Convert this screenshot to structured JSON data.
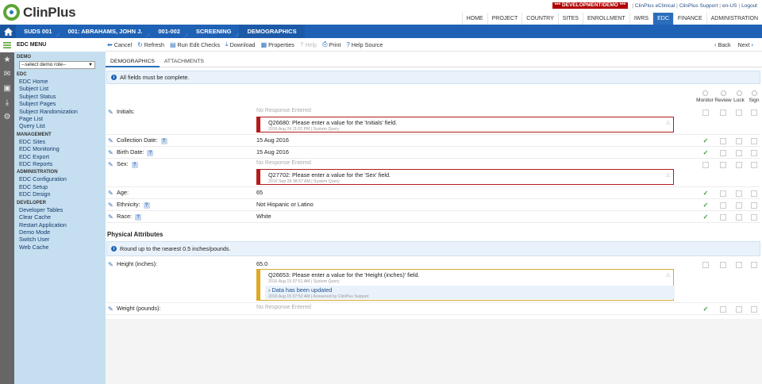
{
  "app": {
    "logo_text": "ClinPlus"
  },
  "top_links": {
    "environment": "*** DEVELOPMENT/DEMO ***",
    "eclinical": "ClinPlus eClinical",
    "support": "ClinPlus Support",
    "locale": "en-US",
    "logout": "Logout",
    "separator": "|"
  },
  "main_nav": [
    "HOME",
    "PROJECT",
    "COUNTRY",
    "SITES",
    "ENROLLMENT",
    "IWRS",
    "EDC",
    "FINANCE",
    "ADMINISTRATION"
  ],
  "main_nav_active": "EDC",
  "breadcrumbs": [
    "SUDS 001",
    "001: ABRAHAMS, JOHN J.",
    "001-002",
    "SCREENING",
    "DEMOGRAPHICS"
  ],
  "sidebar": {
    "title": "EDC MENU",
    "demo_label": "DEMO",
    "role_select": "--select demo role--",
    "sections": [
      {
        "title": "EDC",
        "items": [
          "EDC Home",
          "Subject List",
          "Subject Status",
          "Subject Pages",
          "Subject Randomization",
          "Page List",
          "Query List"
        ]
      },
      {
        "title": "MANAGEMENT",
        "items": [
          "EDC Sites",
          "EDC Monitoring",
          "EDC Export",
          "EDC Reports"
        ]
      },
      {
        "title": "ADMINISTRATION",
        "items": [
          "EDC Configuration",
          "EDC Setup",
          "EDC Design"
        ]
      },
      {
        "title": "DEVELOPER",
        "items": [
          "Developer Tables",
          "Clear Cache",
          "Restart Application",
          "Demo Mode",
          "Switch User",
          "Web Cache"
        ]
      }
    ]
  },
  "toolbar": {
    "cancel": "Cancel",
    "refresh": "Refresh",
    "run_edit_checks": "Run Edit Checks",
    "download": "Download",
    "properties": "Properties",
    "help": "Help",
    "print": "Print",
    "help_source": "Help Source",
    "back": "Back",
    "next": "Next"
  },
  "tabs": [
    "DEMOGRAPHICS",
    "ATTACHMENTS"
  ],
  "notice_complete": "All fields must be complete.",
  "status_columns": [
    "Monitor",
    "Review",
    "Lock",
    "Sign"
  ],
  "section_title": "Physical Attributes",
  "notice_round": "Round up to the nearest 0.5 inches/pounds.",
  "no_response": "No Response Entered",
  "fields": {
    "initials": {
      "label": "Initials:",
      "value": "No Response Entered",
      "monitored": false,
      "query": {
        "text": "Q26680: Please enter a value for the 'Initials' field.",
        "meta": "2016 Aug 24 11:02 PM | System Query"
      }
    },
    "collection_date": {
      "label": "Collection Date:",
      "value": "15 Aug 2016",
      "monitored": true
    },
    "birth_date": {
      "label": "Birth Date:",
      "value": "15 Aug 2016",
      "monitored": true
    },
    "sex": {
      "label": "Sex:",
      "value": "No Response Entered",
      "monitored": false,
      "query": {
        "text": "Q27702: Please enter a value for the 'Sex' field.",
        "meta": "2016 Sep 28 08:57 AM | System Query"
      }
    },
    "age": {
      "label": "Age:",
      "value": "65",
      "monitored": true
    },
    "ethnicity": {
      "label": "Ethnicity:",
      "value": "Not Hispanic or Latino",
      "monitored": true
    },
    "race": {
      "label": "Race:",
      "value": "White",
      "monitored": true
    },
    "height": {
      "label": "Height (inches):",
      "value": "65.0",
      "monitored": false,
      "query": {
        "text": "Q26653: Please enter a value for the 'Height (inches)' field.",
        "meta": "2016 Aug 15 07:51 AM | System Query",
        "response": "Data has been updated",
        "response_meta": "2016 Aug 15 07:52 AM | Answered by ClinPlus Support"
      }
    },
    "weight": {
      "label": "Weight (pounds):",
      "value": "No Response Entered",
      "monitored": true
    }
  },
  "colors": {
    "brand_blue": "#1f62b5",
    "brand_green": "#5aa535",
    "query_red": "#b31b1b",
    "query_amber": "#e0a922",
    "sidebar_bg": "#c5dff0"
  }
}
